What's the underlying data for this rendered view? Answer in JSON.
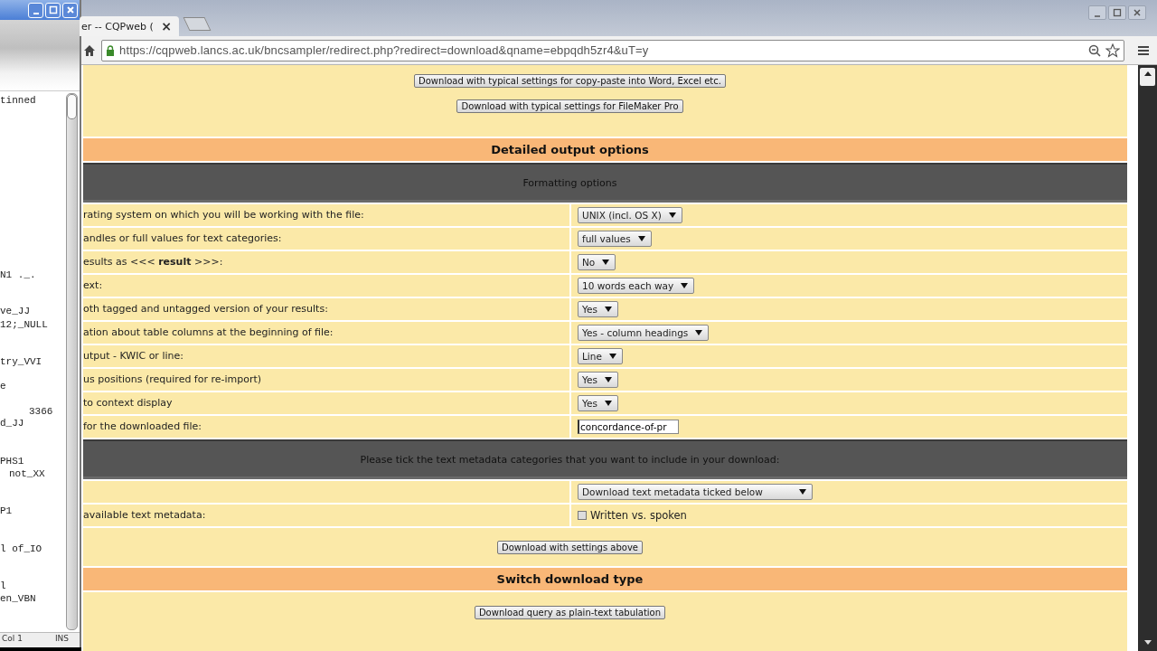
{
  "editor": {
    "lines": [
      "tinned",
      "N1 ._.",
      "ve_JJ",
      "12;_NULL",
      "try_VVI",
      "e",
      "3366",
      "d_JJ",
      "PHS1",
      "not_XX",
      "P1",
      "l of_IO",
      "l",
      "en_VBN"
    ],
    "status": {
      "position": "Col 1",
      "mode": "INS"
    }
  },
  "browser": {
    "tab": {
      "title": "er -- CQPweb (",
      "close": "×"
    },
    "url": "https://cqpweb.lancs.ac.uk/bncsampler/redirect.php?redirect=download&qname=ebpqdh5zr4&uT=y"
  },
  "page": {
    "quick_buttons": [
      "Download with typical settings for copy-paste into Word, Excel etc.",
      "Download with typical settings for FileMaker Pro"
    ],
    "detailed_header": "Detailed output options",
    "formatting_header": "Formatting options",
    "options": [
      {
        "label": "rating system on which you will be working with the file:",
        "kind": "select",
        "value": "UNIX (incl. OS X)"
      },
      {
        "label": "andles or full values for text categories:",
        "kind": "select",
        "value": "full values"
      },
      {
        "label": "esults as <<< **result** >>>:",
        "kind": "select",
        "value": "No"
      },
      {
        "label": "ext:",
        "kind": "select",
        "value": "10 words each way"
      },
      {
        "label": "oth tagged and untagged version of your results:",
        "kind": "select",
        "value": "Yes"
      },
      {
        "label": "ation about table columns at the beginning of file:",
        "kind": "select",
        "value": "Yes - column headings"
      },
      {
        "label": "utput - KWIC or line:",
        "kind": "select",
        "value": "Line"
      },
      {
        "label": "us positions (required for re-import)",
        "kind": "select",
        "value": "Yes"
      },
      {
        "label": "to context display",
        "kind": "select",
        "value": "Yes"
      },
      {
        "label": "for the downloaded file:",
        "kind": "text",
        "value": "concordance-of-pr"
      }
    ],
    "metadata_header": "Please tick the text metadata categories that you want to include in your download:",
    "metadata_select": "Download text metadata ticked below",
    "metadata_label": "available text metadata:",
    "metadata_checkbox": {
      "label": "Written vs. spoken",
      "checked": false
    },
    "settings_button": "Download with settings above",
    "switch_header": "Switch download type",
    "tabulation_button": "Download query as plain-text tabulation"
  }
}
